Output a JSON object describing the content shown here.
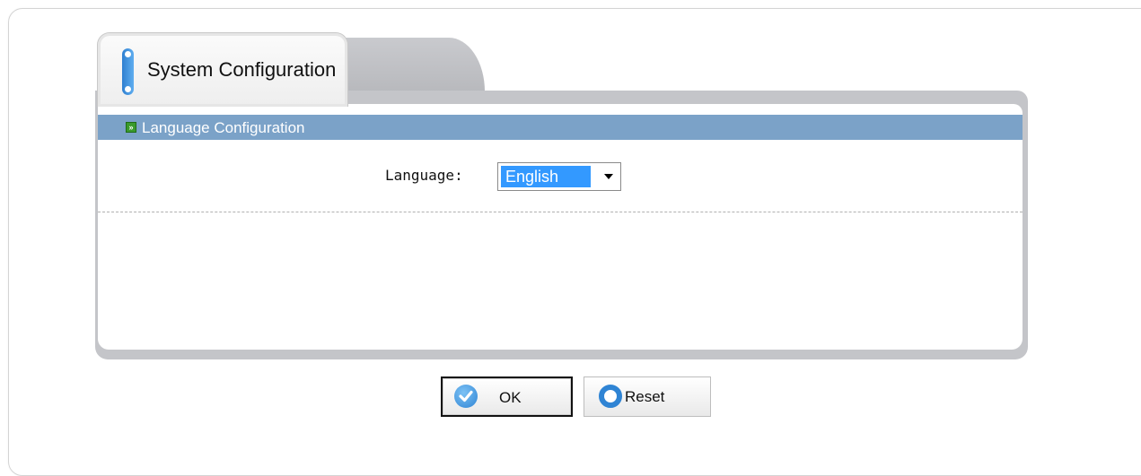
{
  "tab": {
    "title": "System Configuration"
  },
  "section": {
    "title": "Language Configuration",
    "icon": "expand-icon"
  },
  "form": {
    "language_label": "Language:",
    "language_value": "English"
  },
  "buttons": {
    "ok_label": "OK",
    "reset_label": "Reset",
    "ok_icon": "check-icon",
    "reset_icon": "circle-icon"
  },
  "colors": {
    "section_header": "#7ba2c8",
    "select_highlight": "#3399ff",
    "accent_blue": "#2f84d4"
  }
}
